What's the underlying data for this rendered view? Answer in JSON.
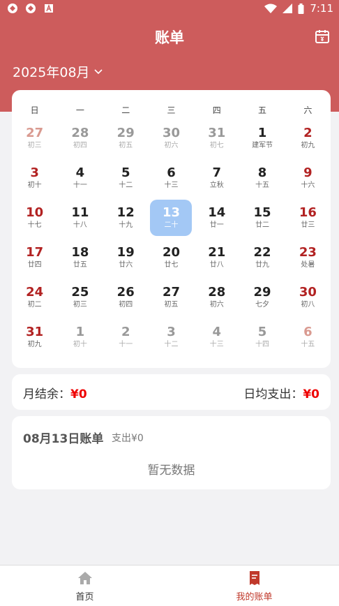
{
  "status_bar": {
    "time": "7:11",
    "icons": [
      "sync-icon",
      "sync-icon",
      "text-a-icon",
      "wifi-icon",
      "signal-icon",
      "battery-icon"
    ]
  },
  "header": {
    "title": "账单",
    "calendar_icon": "calendar-icon",
    "month_label": "2025年08月",
    "dropdown_icon": "chevron-down-icon"
  },
  "calendar": {
    "weekdays": [
      "日",
      "一",
      "二",
      "三",
      "四",
      "五",
      "六"
    ],
    "days": [
      {
        "num": "27",
        "lunar": "初三",
        "other": true
      },
      {
        "num": "28",
        "lunar": "初四",
        "other": true
      },
      {
        "num": "29",
        "lunar": "初五",
        "other": true
      },
      {
        "num": "30",
        "lunar": "初六",
        "other": true
      },
      {
        "num": "31",
        "lunar": "初七",
        "other": true
      },
      {
        "num": "1",
        "lunar": "建军节",
        "other": false
      },
      {
        "num": "2",
        "lunar": "初九",
        "other": false
      },
      {
        "num": "3",
        "lunar": "初十",
        "other": false
      },
      {
        "num": "4",
        "lunar": "十一",
        "other": false
      },
      {
        "num": "5",
        "lunar": "十二",
        "other": false
      },
      {
        "num": "6",
        "lunar": "十三",
        "other": false
      },
      {
        "num": "7",
        "lunar": "立秋",
        "other": false
      },
      {
        "num": "8",
        "lunar": "十五",
        "other": false
      },
      {
        "num": "9",
        "lunar": "十六",
        "other": false
      },
      {
        "num": "10",
        "lunar": "十七",
        "other": false
      },
      {
        "num": "11",
        "lunar": "十八",
        "other": false
      },
      {
        "num": "12",
        "lunar": "十九",
        "other": false
      },
      {
        "num": "13",
        "lunar": "二十",
        "other": false,
        "selected": true
      },
      {
        "num": "14",
        "lunar": "廿一",
        "other": false
      },
      {
        "num": "15",
        "lunar": "廿二",
        "other": false
      },
      {
        "num": "16",
        "lunar": "廿三",
        "other": false
      },
      {
        "num": "17",
        "lunar": "廿四",
        "other": false
      },
      {
        "num": "18",
        "lunar": "廿五",
        "other": false
      },
      {
        "num": "19",
        "lunar": "廿六",
        "other": false
      },
      {
        "num": "20",
        "lunar": "廿七",
        "other": false
      },
      {
        "num": "21",
        "lunar": "廿八",
        "other": false
      },
      {
        "num": "22",
        "lunar": "廿九",
        "other": false
      },
      {
        "num": "23",
        "lunar": "处暑",
        "other": false
      },
      {
        "num": "24",
        "lunar": "初二",
        "other": false
      },
      {
        "num": "25",
        "lunar": "初三",
        "other": false
      },
      {
        "num": "26",
        "lunar": "初四",
        "other": false
      },
      {
        "num": "27",
        "lunar": "初五",
        "other": false
      },
      {
        "num": "28",
        "lunar": "初六",
        "other": false
      },
      {
        "num": "29",
        "lunar": "七夕",
        "other": false
      },
      {
        "num": "30",
        "lunar": "初八",
        "other": false
      },
      {
        "num": "31",
        "lunar": "初九",
        "other": false
      },
      {
        "num": "1",
        "lunar": "初十",
        "other": true
      },
      {
        "num": "2",
        "lunar": "十一",
        "other": true
      },
      {
        "num": "3",
        "lunar": "十二",
        "other": true
      },
      {
        "num": "4",
        "lunar": "十三",
        "other": true
      },
      {
        "num": "5",
        "lunar": "十四",
        "other": true
      },
      {
        "num": "6",
        "lunar": "十五",
        "other": true
      }
    ]
  },
  "summary": {
    "month_balance_label": "月结余：",
    "month_balance_value": "¥0",
    "daily_avg_label": "日均支出：",
    "daily_avg_value": "¥0"
  },
  "bill": {
    "title": "08月13日账单",
    "expense": "支出¥0",
    "empty_text": "暂无数据"
  },
  "bottom_nav": {
    "items": [
      {
        "label": "首页",
        "icon": "home-icon",
        "active": false
      },
      {
        "label": "我的账单",
        "icon": "bill-icon",
        "active": true
      }
    ]
  },
  "colors": {
    "primary": "#cd5c5c",
    "weekend": "#b22222",
    "selected": "#a3c8f5",
    "amount": "#ee0000",
    "nav_active": "#c0392b"
  }
}
